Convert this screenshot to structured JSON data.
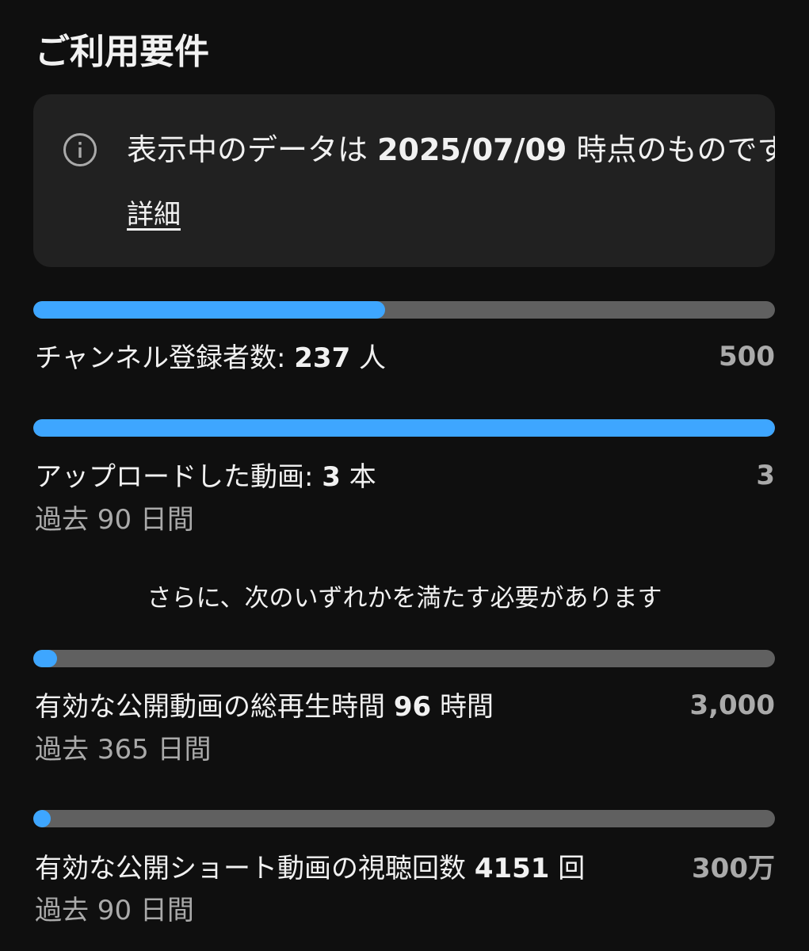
{
  "header": {
    "title": "ご利用要件"
  },
  "notice": {
    "icon": "info-icon",
    "text_prefix": "表示中のデータは ",
    "date": "2025/07/09",
    "text_suffix": " 時点のものです",
    "link_label": "詳細"
  },
  "requirements": [
    {
      "label_prefix": "チャンネル登録者数: ",
      "value": "237",
      "label_suffix": " 人",
      "target": "500",
      "progress": 0.474,
      "period": ""
    },
    {
      "label_prefix": "アップロードした動画: ",
      "value": "3",
      "label_suffix": " 本",
      "target": "3",
      "progress": 1.0,
      "period": "過去 90 日間"
    }
  ],
  "divider_text": "さらに、次のいずれかを満たす必要があります",
  "alternatives": [
    {
      "label_prefix": "有効な公開動画の総再生時間 ",
      "value": "96",
      "label_suffix": " 時間",
      "target": "3,000",
      "progress": 0.032,
      "period": "過去 365 日間"
    },
    {
      "label_prefix": "有効な公開ショート動画の視聴回数 ",
      "value": "4151",
      "label_suffix": " 回",
      "target": "300万",
      "progress": 0.0014,
      "period": "過去 90 日間"
    }
  ],
  "colors": {
    "background": "#0f0f0f",
    "card": "#212121",
    "track": "#606060",
    "progress": "#3ea6ff",
    "secondary_text": "#aaaaaa"
  }
}
